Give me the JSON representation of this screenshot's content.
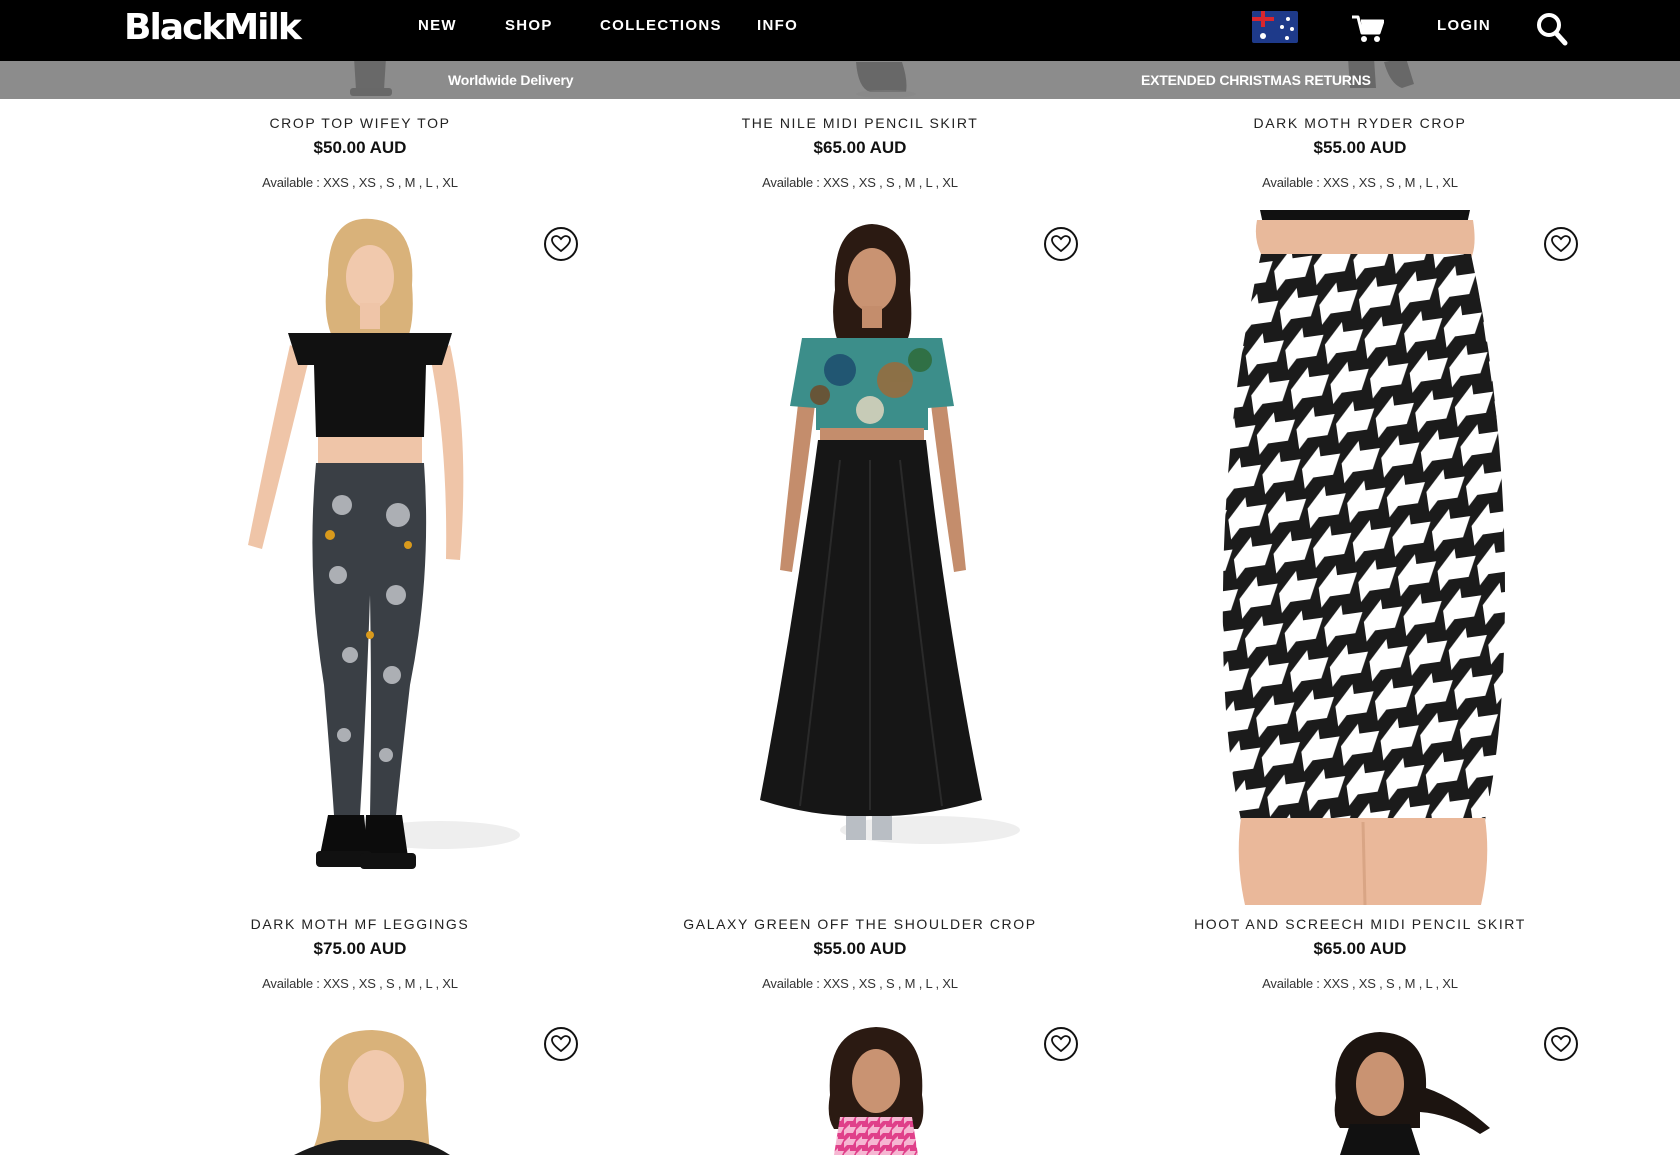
{
  "header": {
    "logo": "BlackMilk",
    "nav": [
      "NEW",
      "SHOP",
      "COLLECTIONS",
      "INFO"
    ],
    "country_icon": "australia-flag-icon",
    "cart_icon": "cart-icon",
    "login": "LOGIN",
    "search_icon": "search-icon"
  },
  "promo": {
    "left": "Worldwide Delivery",
    "right": "EXTENDED CHRISTMAS RETURNS"
  },
  "products": [
    {
      "title": "CROP TOP WIFEY TOP",
      "price": "$50.00 AUD",
      "available": "Available : XXS , XS , S , M , L , XL"
    },
    {
      "title": "THE NILE MIDI PENCIL SKIRT",
      "price": "$65.00 AUD",
      "available": "Available : XXS , XS , S , M , L , XL"
    },
    {
      "title": "DARK MOTH RYDER CROP",
      "price": "$55.00 AUD",
      "available": "Available : XXS , XS , S , M , L , XL"
    },
    {
      "title": "DARK MOTH MF LEGGINGS",
      "price": "$75.00 AUD",
      "available": "Available : XXS , XS , S , M , L , XL"
    },
    {
      "title": "GALAXY GREEN OFF THE SHOULDER CROP",
      "price": "$55.00 AUD",
      "available": "Available : XXS , XS , S , M , L , XL"
    },
    {
      "title": "HOOT AND SCREECH MIDI PENCIL SKIRT",
      "price": "$65.00 AUD",
      "available": "Available : XXS , XS , S , M , L , XL"
    }
  ],
  "favorite_icon": "heart-icon",
  "colors": {
    "header_bg": "#000000",
    "promo_bg": "#787878",
    "text": "#111111"
  }
}
